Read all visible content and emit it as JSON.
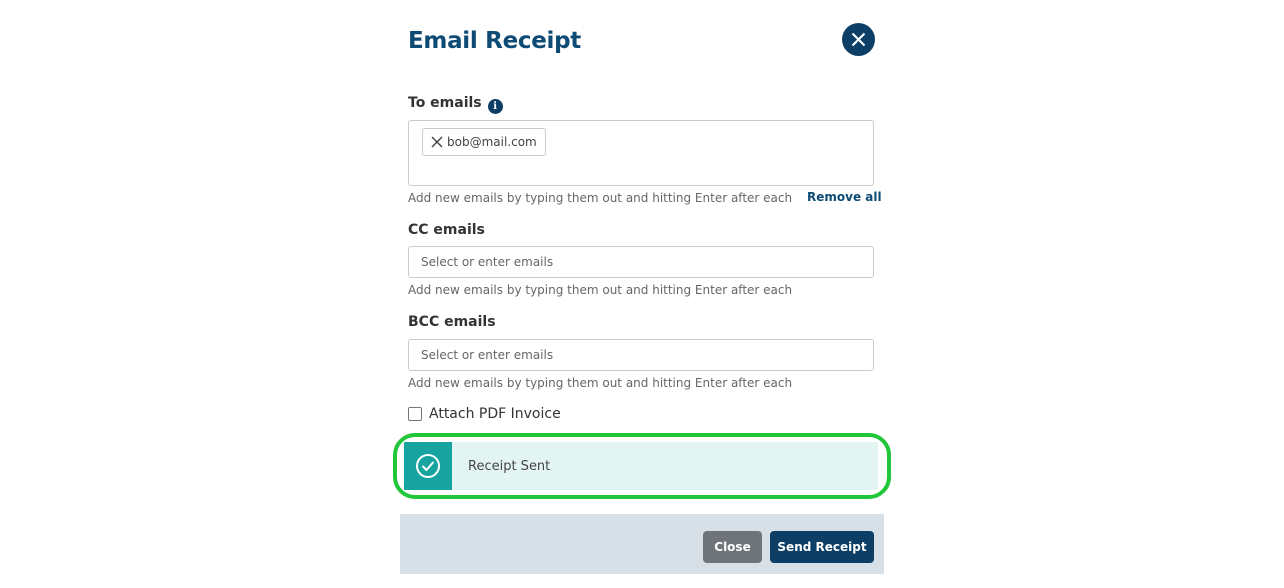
{
  "modal": {
    "title": "Email Receipt"
  },
  "to_emails": {
    "label": "To emails",
    "chips": [
      "bob@mail.com"
    ],
    "help": "Add new emails by typing them out and hitting Enter after each",
    "remove_all": "Remove all"
  },
  "cc_emails": {
    "label": "CC emails",
    "placeholder": "Select or enter emails",
    "help": "Add new emails by typing them out and hitting Enter after each"
  },
  "bcc_emails": {
    "label": "BCC emails",
    "placeholder": "Select or enter emails",
    "help": "Add new emails by typing them out and hitting Enter after each"
  },
  "attach_pdf": {
    "label": "Attach PDF Invoice",
    "checked": false
  },
  "toast": {
    "message": "Receipt Sent",
    "icon": "check-circle-icon"
  },
  "footer": {
    "close_label": "Close",
    "send_label": "Send Receipt"
  },
  "colors": {
    "primary": "#0d3f66",
    "title": "#0d4b75",
    "success_outline": "#22c63a",
    "toast_bg": "#e3f5f3",
    "toast_icon_bg": "#17a3a0",
    "footer_bg": "#d6e0e6",
    "close_button": "#6e7479"
  }
}
